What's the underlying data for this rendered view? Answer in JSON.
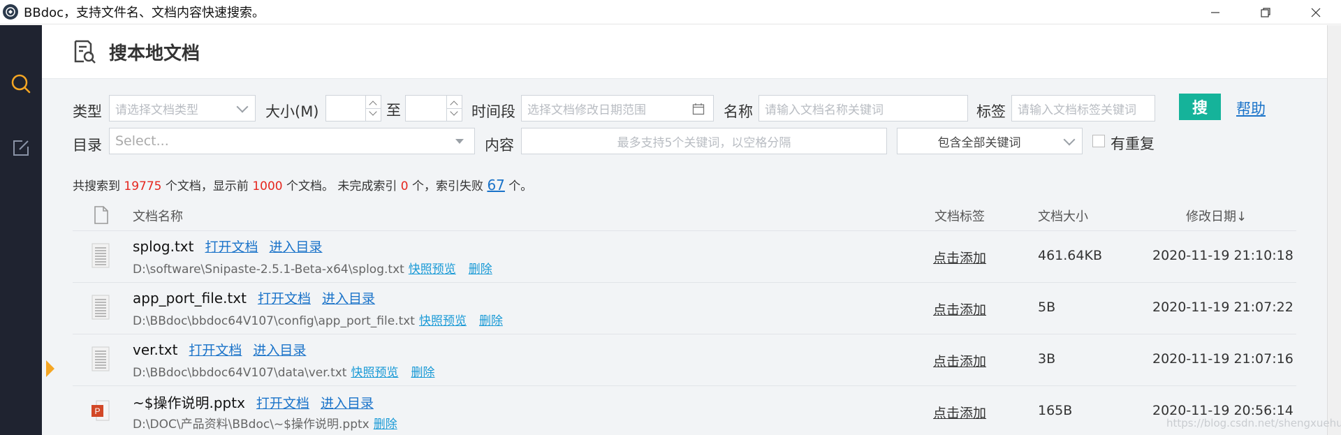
{
  "window": {
    "title": "BBdoc，支持文件名、文档内容快速搜索。",
    "minimize_icon": "minimize-icon",
    "maximize_icon": "restore-icon",
    "close_icon": "close-icon"
  },
  "sidebar": {
    "items": [
      {
        "icon": "search-icon",
        "active": true,
        "color": "#f5a623"
      },
      {
        "icon": "edit-icon",
        "active": false,
        "color": "#8a93a6"
      }
    ]
  },
  "header": {
    "icon": "document-search-icon",
    "title": "搜本地文档"
  },
  "filters": {
    "type_label": "类型",
    "type_placeholder": "请选择文档类型",
    "size_label": "大小(M)",
    "size_to": "至",
    "period_label": "时间段",
    "period_placeholder": "选择文档修改日期范围",
    "name_label": "名称",
    "name_placeholder": "请输入文档名称关键词",
    "tag_label": "标签",
    "tag_placeholder": "请输入文档标签关键词",
    "search_button": "搜",
    "help_link": "帮助",
    "dir_label": "目录",
    "dir_placeholder": "Select...",
    "content_label": "内容",
    "content_placeholder": "最多支持5个关键词，以空格分隔",
    "match_mode": "包含全部关键词",
    "dup_label": "有重复"
  },
  "summary": {
    "p1": "共搜索到 ",
    "total": "19775",
    "p2": " 个文档，显示前 ",
    "shown": "1000",
    "p3": " 个文档。 未完成索引 ",
    "unindexed": "0",
    "p4": " 个，索引失败 ",
    "failed": "67",
    "p5": " 个。"
  },
  "table": {
    "col_name": "文档名称",
    "col_tag": "文档标签",
    "col_size": "文档大小",
    "col_date": "修改日期↓",
    "open_label": "打开文档",
    "enter_dir_label": "进入目录",
    "preview_label": "快照预览",
    "delete_label": "删除",
    "tag_add_label": "点击添加",
    "rows": [
      {
        "name": "splog.txt",
        "path": "D:\\software\\Snipaste-2.5.1-Beta-x64\\splog.txt",
        "size": "461.64KB",
        "date": "2020-11-19 21:10:18",
        "icon": "text-file-icon",
        "preview": true
      },
      {
        "name": "app_port_file.txt",
        "path": "D:\\BBdoc\\bbdoc64V107\\config\\app_port_file.txt",
        "size": "5B",
        "date": "2020-11-19 21:07:22",
        "icon": "text-file-icon",
        "preview": true
      },
      {
        "name": "ver.txt",
        "path": "D:\\BBdoc\\bbdoc64V107\\data\\ver.txt",
        "size": "3B",
        "date": "2020-11-19 21:07:16",
        "icon": "text-file-icon",
        "preview": true
      },
      {
        "name": "~$操作说明.pptx",
        "path": "D:\\DOC\\产品资料\\BBdoc\\~$操作说明.pptx",
        "size": "165B",
        "date": "2020-11-19 20:56:14",
        "icon": "pptx-file-icon",
        "preview": false
      }
    ]
  },
  "watermark": "https://blog.csdn.net/shengxuehua",
  "colors": {
    "accent": "#15b39a",
    "link": "#1a73c9",
    "highlight": "#e5261e",
    "sidebar": "#1f2330"
  }
}
